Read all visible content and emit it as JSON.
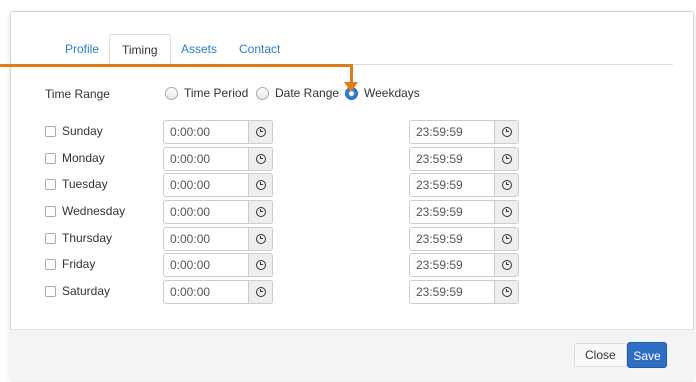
{
  "tabs": [
    {
      "label": "Profile",
      "active": false
    },
    {
      "label": "Timing",
      "active": true
    },
    {
      "label": "Assets",
      "active": false
    },
    {
      "label": "Contact",
      "active": false
    }
  ],
  "time_range": {
    "label": "Time Range",
    "options": [
      {
        "label": "Time Period",
        "checked": false
      },
      {
        "label": "Date Range",
        "checked": false
      },
      {
        "label": "Weekdays",
        "checked": true
      }
    ]
  },
  "days": [
    {
      "name": "Sunday",
      "start": "0:00:00",
      "end": "23:59:59",
      "checked": false
    },
    {
      "name": "Monday",
      "start": "0:00:00",
      "end": "23:59:59",
      "checked": false
    },
    {
      "name": "Tuesday",
      "start": "0:00:00",
      "end": "23:59:59",
      "checked": false
    },
    {
      "name": "Wednesday",
      "start": "0:00:00",
      "end": "23:59:59",
      "checked": false
    },
    {
      "name": "Thursday",
      "start": "0:00:00",
      "end": "23:59:59",
      "checked": false
    },
    {
      "name": "Friday",
      "start": "0:00:00",
      "end": "23:59:59",
      "checked": false
    },
    {
      "name": "Saturday",
      "start": "0:00:00",
      "end": "23:59:59",
      "checked": false
    }
  ],
  "footer": {
    "close_label": "Close",
    "save_label": "Save"
  },
  "colors": {
    "accent": "#2f6fc3",
    "link": "#2a7fc9",
    "annotation": "#e07b1a"
  },
  "icons": {
    "time_addon": "clock-icon"
  }
}
